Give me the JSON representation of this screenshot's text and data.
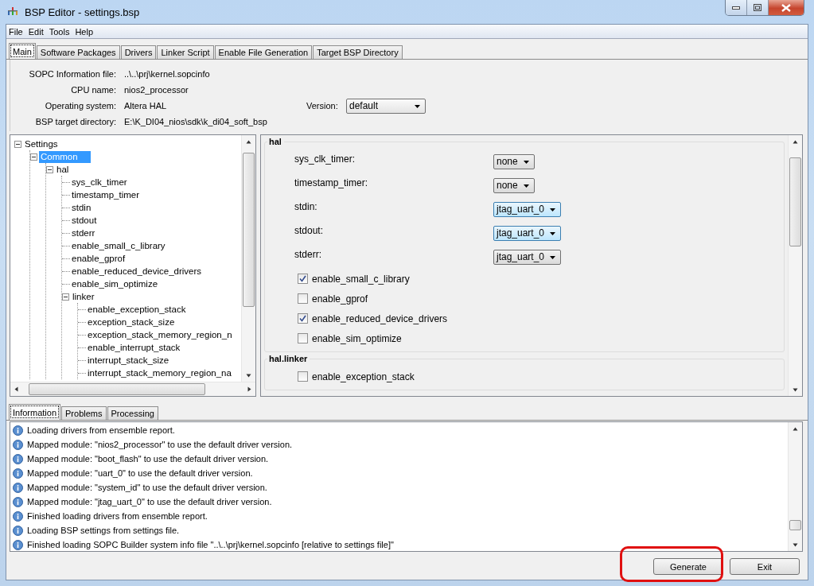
{
  "window": {
    "title": "BSP Editor - settings.bsp"
  },
  "menu": [
    "File",
    "Edit",
    "Tools",
    "Help"
  ],
  "tabs": [
    {
      "label": "Main",
      "selected": true
    },
    {
      "label": "Software Packages",
      "selected": false
    },
    {
      "label": "Drivers",
      "selected": false
    },
    {
      "label": "Linker Script",
      "selected": false
    },
    {
      "label": "Enable File Generation",
      "selected": false
    },
    {
      "label": "Target BSP Directory",
      "selected": false
    }
  ],
  "info": [
    {
      "label": "SOPC Information file:",
      "value": "..\\..\\prj\\kernel.sopcinfo"
    },
    {
      "label": "CPU name:",
      "value": "nios2_processor"
    },
    {
      "label": "Operating system:",
      "value": "Altera HAL",
      "version": {
        "label": "Version:",
        "value": "default"
      }
    },
    {
      "label": "BSP target directory:",
      "value": "E:\\K_DI04_nios\\sdk\\k_di04_soft_bsp"
    }
  ],
  "tree": {
    "label": "Settings",
    "selected": false,
    "expanded": true,
    "children": [
      {
        "label": "Common",
        "selected": true,
        "expanded": true,
        "children": [
          {
            "label": "hal",
            "selected": false,
            "expanded": true,
            "children": [
              {
                "label": "sys_clk_timer",
                "selected": false
              },
              {
                "label": "timestamp_timer",
                "selected": false
              },
              {
                "label": "stdin",
                "selected": false
              },
              {
                "label": "stdout",
                "selected": false
              },
              {
                "label": "stderr",
                "selected": false
              },
              {
                "label": "enable_small_c_library",
                "selected": false
              },
              {
                "label": "enable_gprof",
                "selected": false
              },
              {
                "label": "enable_reduced_device_drivers",
                "selected": false
              },
              {
                "label": "enable_sim_optimize",
                "selected": false
              },
              {
                "label": "linker",
                "selected": false,
                "expanded": true,
                "children": [
                  {
                    "label": "enable_exception_stack",
                    "selected": false
                  },
                  {
                    "label": "exception_stack_size",
                    "selected": false
                  },
                  {
                    "label": "exception_stack_memory_region_n",
                    "selected": false
                  },
                  {
                    "label": "enable_interrupt_stack",
                    "selected": false
                  },
                  {
                    "label": "interrupt_stack_size",
                    "selected": false
                  },
                  {
                    "label": "interrupt_stack_memory_region_na",
                    "selected": false
                  }
                ]
              }
            ]
          }
        ]
      }
    ]
  },
  "groups": [
    {
      "title": "hal",
      "settings": [
        {
          "kind": "combo",
          "label": "sys_clk_timer:",
          "value": "none",
          "highlighted": false
        },
        {
          "kind": "combo",
          "label": "timestamp_timer:",
          "value": "none",
          "highlighted": false
        },
        {
          "kind": "combo",
          "label": "stdin:",
          "value": "jtag_uart_0",
          "highlighted": true
        },
        {
          "kind": "combo",
          "label": "stdout:",
          "value": "jtag_uart_0",
          "highlighted": true
        },
        {
          "kind": "combo",
          "label": "stderr:",
          "value": "jtag_uart_0",
          "highlighted": false
        },
        {
          "kind": "checkbox",
          "label": "enable_small_c_library",
          "checked": true
        },
        {
          "kind": "checkbox",
          "label": "enable_gprof",
          "checked": false
        },
        {
          "kind": "checkbox",
          "label": "enable_reduced_device_drivers",
          "checked": true
        },
        {
          "kind": "checkbox",
          "label": "enable_sim_optimize",
          "checked": false
        }
      ]
    },
    {
      "title": "hal.linker",
      "settings": [
        {
          "kind": "checkbox",
          "label": "enable_exception_stack",
          "checked": false
        }
      ]
    }
  ],
  "log_tabs": [
    {
      "label": "Information",
      "selected": true
    },
    {
      "label": "Problems",
      "selected": false
    },
    {
      "label": "Processing",
      "selected": false
    }
  ],
  "log": [
    "Loading drivers from ensemble report.",
    "Mapped module: \"nios2_processor\" to use the default driver version.",
    "Mapped module: \"boot_flash\" to use the default driver version.",
    "Mapped module: \"uart_0\" to use the default driver version.",
    "Mapped module: \"system_id\" to use the default driver version.",
    "Mapped module: \"jtag_uart_0\" to use the default driver version.",
    "Finished loading drivers from ensemble report.",
    "Loading BSP settings from settings file.",
    "Finished loading SOPC Builder system info file \"..\\..\\prj\\kernel.sopcinfo [relative to settings file]\""
  ],
  "buttons": [
    {
      "label": "Generate",
      "highlighted": true
    },
    {
      "label": "Exit",
      "highlighted": false
    }
  ]
}
